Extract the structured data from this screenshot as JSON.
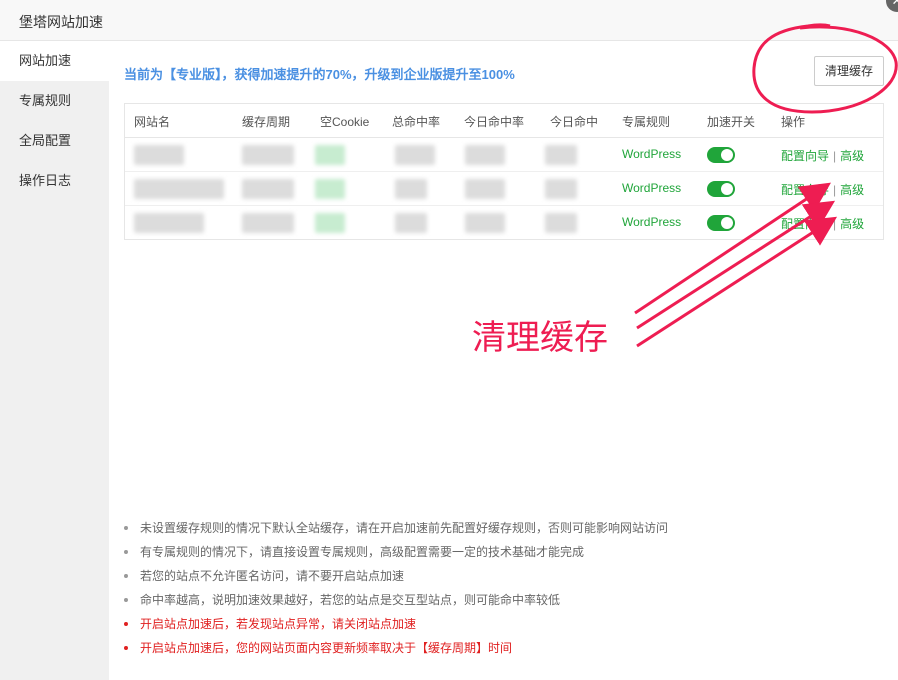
{
  "window": {
    "title": "堡塔网站加速"
  },
  "sidebar": {
    "items": [
      {
        "label": "网站加速",
        "active": true
      },
      {
        "label": "专属规则",
        "active": false
      },
      {
        "label": "全局配置",
        "active": false
      },
      {
        "label": "操作日志",
        "active": false
      }
    ]
  },
  "main": {
    "notice": "当前为【专业版】，获得加速提升的70%，升级到企业版提升至100%",
    "clear_cache_button": "清理缓存",
    "table": {
      "headers": [
        "网站名",
        "缓存周期",
        "空Cookie",
        "总命中率",
        "今日命中率",
        "今日命中",
        "专属规则",
        "加速开关",
        "操作"
      ],
      "rows": [
        {
          "rule": "WordPress",
          "enabled": true,
          "config_link": "配置向导",
          "advanced_link": "高级"
        },
        {
          "rule": "WordPress",
          "enabled": true,
          "config_link": "配置向导",
          "advanced_link": "高级"
        },
        {
          "rule": "WordPress",
          "enabled": true,
          "config_link": "配置向导",
          "advanced_link": "高级"
        }
      ],
      "separator": "|"
    },
    "tips": [
      {
        "text": "未设置缓存规则的情况下默认全站缓存，请在开启加速前先配置好缓存规则，否则可能影响网站访问",
        "warning": false
      },
      {
        "text": "有专属规则的情况下，请直接设置专属规则，高级配置需要一定的技术基础才能完成",
        "warning": false
      },
      {
        "text": "若您的站点不允许匿名访问，请不要开启站点加速",
        "warning": false
      },
      {
        "text": "命中率越高，说明加速效果越好，若您的站点是交互型站点，则可能命中率较低",
        "warning": false
      },
      {
        "text": "开启站点加速后，若发现站点异常，请关闭站点加速",
        "warning": true
      },
      {
        "text": "开启站点加速后，您的网站页面内容更新频率取决于【缓存周期】时间",
        "warning": true
      }
    ]
  },
  "annotation": {
    "label": "清理缓存",
    "color": "#ee1d52"
  },
  "colors": {
    "accent_blue": "#4a90e2",
    "success_green": "#20a53a",
    "warning_red": "#e02020"
  },
  "icons": {
    "close": "close-icon"
  }
}
